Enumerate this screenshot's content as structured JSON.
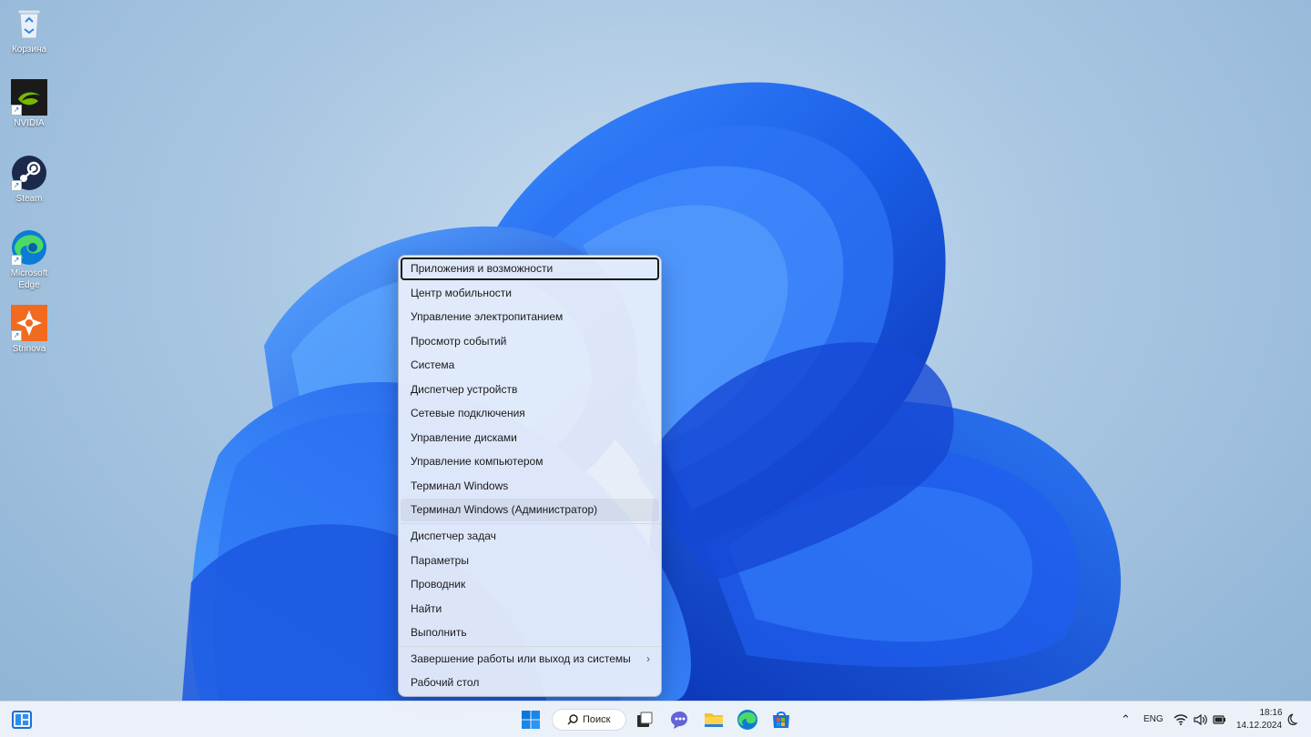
{
  "desktop": {
    "icons": [
      {
        "name": "recycle-bin",
        "label": "Корзина"
      },
      {
        "name": "nvidia",
        "label": "NVIDIA"
      },
      {
        "name": "steam",
        "label": "Steam"
      },
      {
        "name": "edge",
        "label": "Microsoft Edge"
      },
      {
        "name": "strinova",
        "label": "Strinova"
      }
    ]
  },
  "context_menu": {
    "items": [
      {
        "label": "Приложения и возможности",
        "state": "focused"
      },
      {
        "label": "Центр мобильности"
      },
      {
        "label": "Управление электропитанием"
      },
      {
        "label": "Просмотр событий"
      },
      {
        "label": "Система"
      },
      {
        "label": "Диспетчер устройств"
      },
      {
        "label": "Сетевые подключения"
      },
      {
        "label": "Управление дисками"
      },
      {
        "label": "Управление компьютером"
      },
      {
        "label": "Терминал Windows"
      },
      {
        "label": "Терминал Windows (Администратор)",
        "state": "hovered"
      },
      {
        "label": "Диспетчер задач"
      },
      {
        "label": "Параметры"
      },
      {
        "label": "Проводник"
      },
      {
        "label": "Найти"
      },
      {
        "label": "Выполнить"
      },
      {
        "label": "Завершение работы или выход из системы",
        "submenu": "›"
      },
      {
        "label": "Рабочий стол"
      }
    ]
  },
  "taskbar": {
    "search_label": "Поиск",
    "search_icon": "magnifier-icon",
    "language": "ENG",
    "time": "18:16",
    "date": "14.12.2024",
    "accent": "#0078d4"
  }
}
